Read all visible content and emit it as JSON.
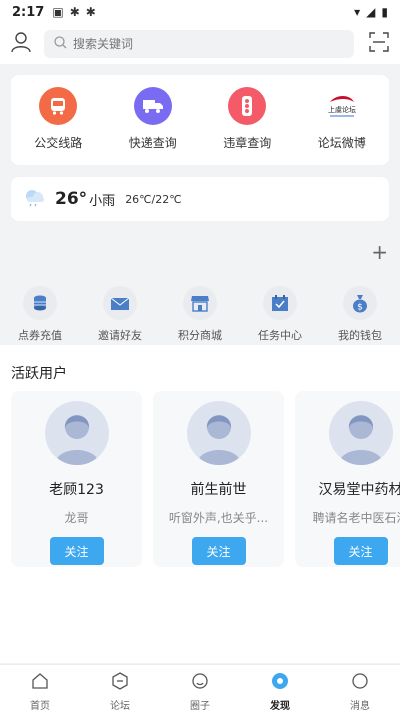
{
  "status_bar": {
    "time": "2:17"
  },
  "search": {
    "placeholder": "搜索关键词"
  },
  "nav": [
    {
      "label": "公交线路",
      "color": "#f26a46",
      "icon": "bus-icon"
    },
    {
      "label": "快递查询",
      "color": "#7a6cf2",
      "icon": "truck-icon"
    },
    {
      "label": "违章查询",
      "color": "#f45a68",
      "icon": "traffic-light-icon"
    },
    {
      "label": "论坛微博",
      "logo_text": "上虞论坛",
      "icon": "forum-logo"
    }
  ],
  "weather": {
    "temp": "26°",
    "condition": "小雨",
    "range": "26℃/22℃"
  },
  "quick_actions": [
    {
      "label": "点券充值",
      "icon": "coins-icon"
    },
    {
      "label": "邀请好友",
      "icon": "envelope-icon"
    },
    {
      "label": "积分商城",
      "icon": "shop-icon"
    },
    {
      "label": "任务中心",
      "icon": "calendar-check-icon"
    },
    {
      "label": "我的钱包",
      "icon": "money-bag-icon"
    }
  ],
  "active_users": {
    "title": "活跃用户",
    "follow_label": "关注",
    "users": [
      {
        "name": "老顾123",
        "signature": "龙哥"
      },
      {
        "name": "前生前世",
        "signature": "听窗外声,也关乎..."
      },
      {
        "name": "汉易堂中药材",
        "signature": "聘请名老中医石浪"
      }
    ]
  },
  "tabs": [
    {
      "label": "首页",
      "icon": "home-icon"
    },
    {
      "label": "论坛",
      "icon": "forum-icon"
    },
    {
      "label": "圈子",
      "icon": "circle-icon"
    },
    {
      "label": "发现",
      "icon": "discover-icon",
      "active": true
    },
    {
      "label": "消息",
      "icon": "message-icon"
    }
  ],
  "colors": {
    "accent": "#3da8f0"
  }
}
